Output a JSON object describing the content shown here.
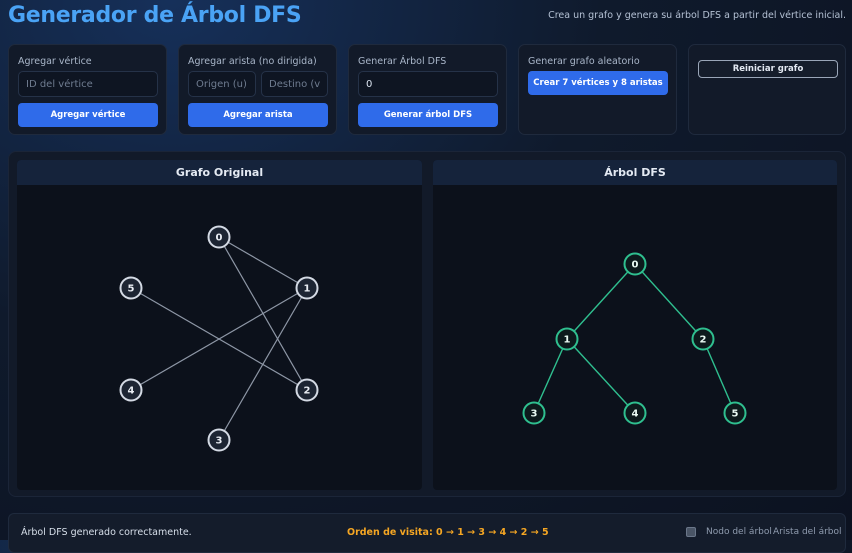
{
  "header": {
    "title": "Generador de Árbol DFS",
    "subtitle": "Crea un grafo y genera su árbol DFS a partir del vértice inicial."
  },
  "controls": {
    "add_vertex": {
      "label": "Agregar vértice",
      "placeholder": "ID del vértice",
      "button": "Agregar vértice"
    },
    "add_edge": {
      "label": "Agregar arista (no dirigida)",
      "origin_placeholder": "Origen (u)",
      "dest_placeholder": "Destino (v)",
      "button": "Agregar arista"
    },
    "generate": {
      "label": "Generar Árbol DFS",
      "start_value": "0",
      "button": "Generar árbol DFS"
    },
    "random": {
      "label": "Generar grafo aleatorio",
      "button": "Crear 7 vértices y 8 aristas"
    },
    "reset": {
      "button": "Reiniciar grafo"
    }
  },
  "original_graph": {
    "title": "Grafo Original",
    "nodes": [
      "0",
      "1",
      "2",
      "3",
      "4",
      "5"
    ],
    "edges": [
      [
        "0",
        "1"
      ],
      [
        "0",
        "2"
      ],
      [
        "1",
        "4"
      ],
      [
        "1",
        "3"
      ],
      [
        "5",
        "2"
      ]
    ]
  },
  "dfs_tree": {
    "title": "Árbol DFS",
    "nodes": [
      "0",
      "1",
      "2",
      "3",
      "4",
      "5"
    ],
    "edges": [
      [
        "0",
        "1"
      ],
      [
        "0",
        "2"
      ],
      [
        "1",
        "3"
      ],
      [
        "1",
        "4"
      ],
      [
        "2",
        "5"
      ]
    ]
  },
  "status": {
    "message": "Árbol DFS generado correctamente.",
    "visit_order": "Orden de visita: 0 → 1 → 3 → 4 → 2 → 5",
    "legend_node": "Nodo del árbol",
    "legend_edge": "Arista del árbol"
  },
  "colors": {
    "accent": "#2f6bea",
    "title": "#4aa3f5",
    "tree": "#2fbf8f",
    "original_node": "#d4dae4",
    "visit_order": "#f5a623"
  }
}
